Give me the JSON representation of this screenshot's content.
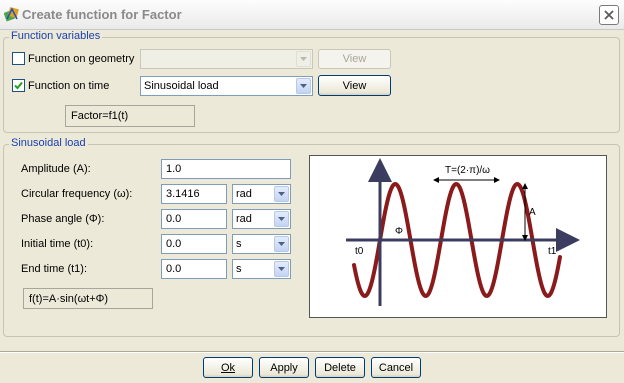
{
  "window": {
    "title": "Create function for Factor",
    "icon": "function-icon",
    "close_icon": "close-icon"
  },
  "function_variables": {
    "legend": "Function variables",
    "geometry": {
      "label": "Function on geometry",
      "checked": false,
      "combo_value": "",
      "view_label": "View"
    },
    "time": {
      "label": "Function on time",
      "checked": true,
      "combo_value": "Sinusoidal load",
      "view_label": "View"
    },
    "factor_text": "Factor=f1(t)"
  },
  "sinusoidal_load": {
    "legend": "Sinusoidal load",
    "fields": [
      {
        "label": "Amplitude (A):",
        "value": "1.0",
        "unit": ""
      },
      {
        "label": "Circular frequency (ω):",
        "value": "3.1416",
        "unit": "rad"
      },
      {
        "label": "Phase angle (Φ):",
        "value": "0.0",
        "unit": "rad"
      },
      {
        "label": "Initial time (t0):",
        "value": "0.0",
        "unit": "s"
      },
      {
        "label": "End time (t1):",
        "value": "0.0",
        "unit": "s"
      }
    ],
    "formula": "f(t)=A·sin(ωt+Φ)",
    "diagram": {
      "period_label": "T=(2·π)/ω",
      "amplitude_label": "A",
      "phase_label": "Φ",
      "t0_label": "t0",
      "t1_label": "t1",
      "curve_color": "#8b1a1a",
      "axis_color": "#3c3c60"
    }
  },
  "buttons": {
    "ok": "Ok",
    "apply": "Apply",
    "delete": "Delete",
    "cancel": "Cancel"
  }
}
